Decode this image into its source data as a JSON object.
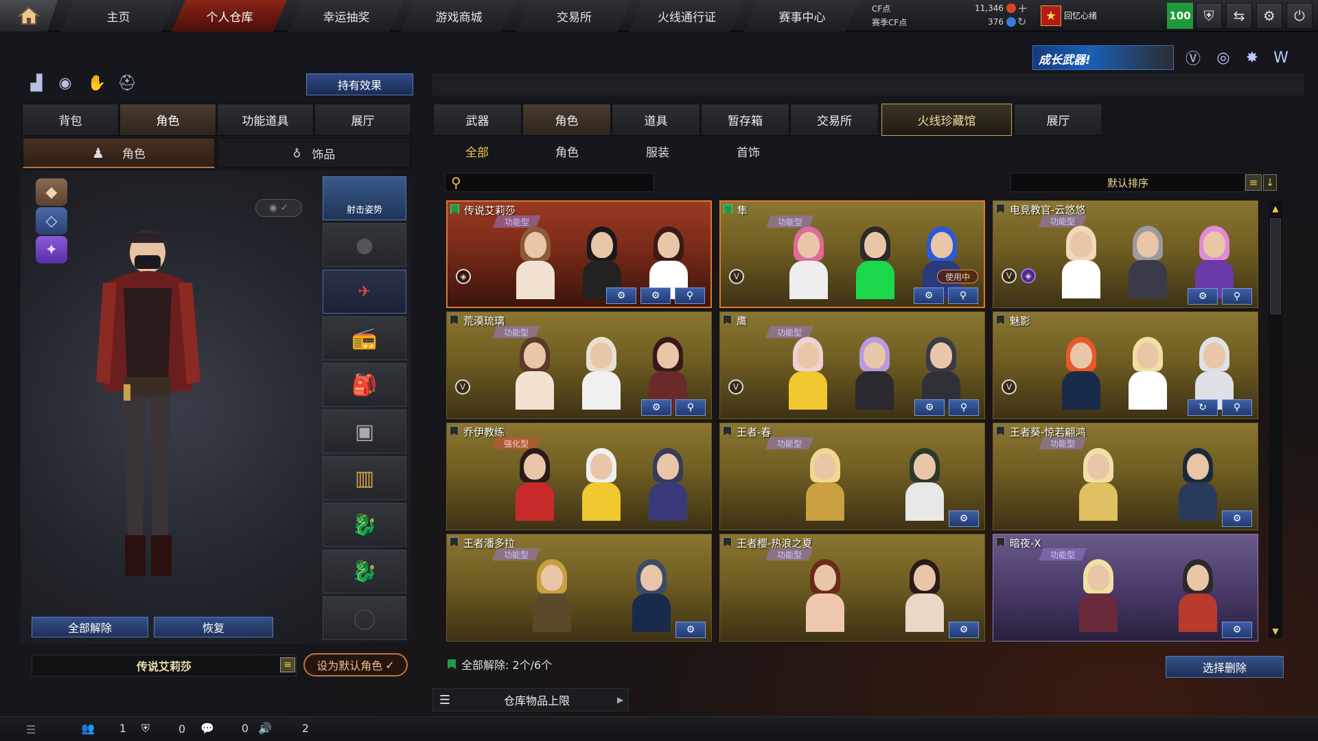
{
  "nav": {
    "tabs": [
      "主页",
      "个人仓库",
      "幸运抽奖",
      "游戏商城",
      "交易所",
      "火线通行证",
      "赛事中心"
    ],
    "active_index": 1
  },
  "currency": {
    "cf_label": "CF点",
    "cf_value": "11,346",
    "season_label": "赛季CF点",
    "season_value": "376"
  },
  "user": {
    "name": "回忆心绪",
    "level": "100"
  },
  "banner": {
    "text": "成长武器!"
  },
  "left": {
    "hold_effect": "持有效果",
    "tabs": [
      "背包",
      "角色",
      "功能道具",
      "展厅"
    ],
    "active_tab": 1,
    "subtabs": [
      "角色",
      "饰品"
    ],
    "slot_label_0": "射击姿势",
    "btn_unequip_all": "全部解除",
    "btn_restore": "恢复",
    "character_name": "传说艾莉莎",
    "set_default": "设为默认角色"
  },
  "right": {
    "tabs": [
      "武器",
      "角色",
      "道具",
      "暂存箱",
      "交易所",
      "火线珍藏馆",
      "展厅"
    ],
    "subtabs": [
      "全部",
      "角色",
      "服装",
      "首饰"
    ],
    "sort_label": "默认排序",
    "unequip_status": "全部解除: 2个/6个",
    "select_delete": "选择删除",
    "storage_label": "仓库物品上限"
  },
  "cards": [
    {
      "name": "传说艾莉莎",
      "type": "功能型"
    },
    {
      "name": "隼",
      "type": "功能型",
      "status": "使用中"
    },
    {
      "name": "电竞教官-云悠悠",
      "type": "功能型"
    },
    {
      "name": "荒漠琉璃",
      "type": "功能型"
    },
    {
      "name": "鹰",
      "type": "功能型"
    },
    {
      "name": "魅影",
      "type": ""
    },
    {
      "name": "乔伊教练",
      "type": "强化型"
    },
    {
      "name": "王者-春",
      "type": "功能型"
    },
    {
      "name": "王者葵-惊若翩鸿",
      "type": "功能型"
    },
    {
      "name": "王者潘多拉",
      "type": "功能型"
    },
    {
      "name": "王者樱-热浪之夏",
      "type": "功能型"
    },
    {
      "name": "暗夜-X",
      "type": "功能型"
    }
  ],
  "statusbar": {
    "c1": "1",
    "c2": "0",
    "c3": "0",
    "c4": "2"
  }
}
